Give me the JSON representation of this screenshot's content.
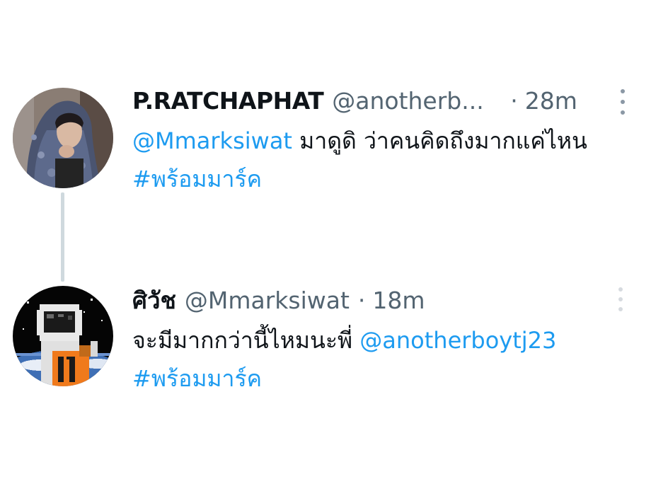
{
  "tweets": [
    {
      "display_name": "P.RATCHAPHAT",
      "handle": "@anotherb...",
      "separator": "·",
      "time": "28m",
      "mention": "@Mmarksiwat",
      "text": " มาดูดิ ว่าคนคิดถึงมากแค่ไหน ",
      "hashtag": "#พร้อมมาร์ค",
      "avatar_icon": "profile-photo-hooded-person"
    },
    {
      "display_name": "ศิวัช",
      "handle": "@Mmarksiwat",
      "separator": "·",
      "time": "18m",
      "text": "จะมีมากกว่านี้ไหมนะพี่ ",
      "mention": "@anotherboytj23",
      "hashtag": "#พร้อมมาร์ค",
      "avatar_icon": "astronaut-pixel-art-avatar"
    }
  ],
  "colors": {
    "link": "#1d9bf0",
    "text": "#0f1419",
    "secondary": "#536471",
    "thread_line": "#cfd9de"
  }
}
